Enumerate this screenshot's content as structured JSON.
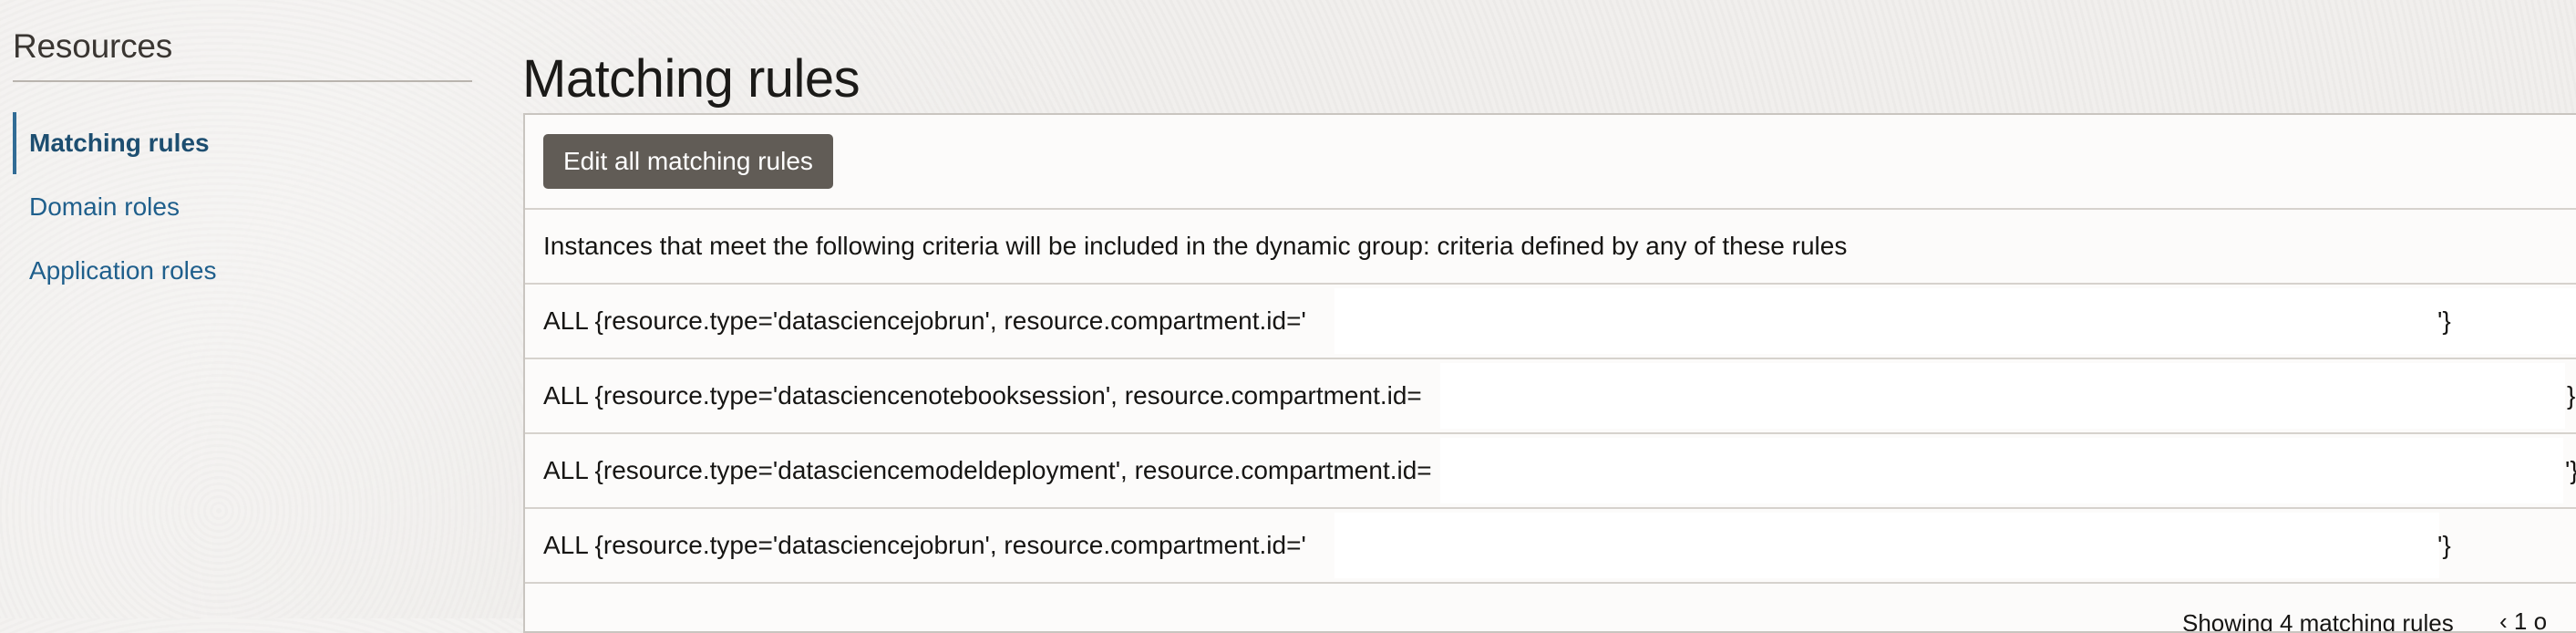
{
  "sidebar": {
    "title": "Resources",
    "items": [
      {
        "label": "Matching rules",
        "active": true
      },
      {
        "label": "Domain roles",
        "active": false
      },
      {
        "label": "Application roles",
        "active": false
      }
    ]
  },
  "main": {
    "title": "Matching rules",
    "edit_button_label": "Edit all matching rules",
    "criteria_text": "Instances that meet the following criteria will be included in the dynamic group: criteria defined by any of these rules",
    "rules": [
      {
        "prefix": "ALL {resource.type='datasciencejobrun', resource.compartment.id='",
        "suffix": "'}"
      },
      {
        "prefix": "ALL {resource.type='datasciencenotebooksession', resource.compartment.id=",
        "suffix": "}"
      },
      {
        "prefix": "ALL {resource.type='datasciencemodeldeployment', resource.compartment.id=",
        "suffix": "'}"
      },
      {
        "prefix": "ALL {resource.type='datasciencejobrun', resource.compartment.id='",
        "suffix": "'}"
      }
    ],
    "footer": {
      "count_text": "Showing 4 matching rules",
      "pager_text": "‹ 1 o"
    }
  }
}
